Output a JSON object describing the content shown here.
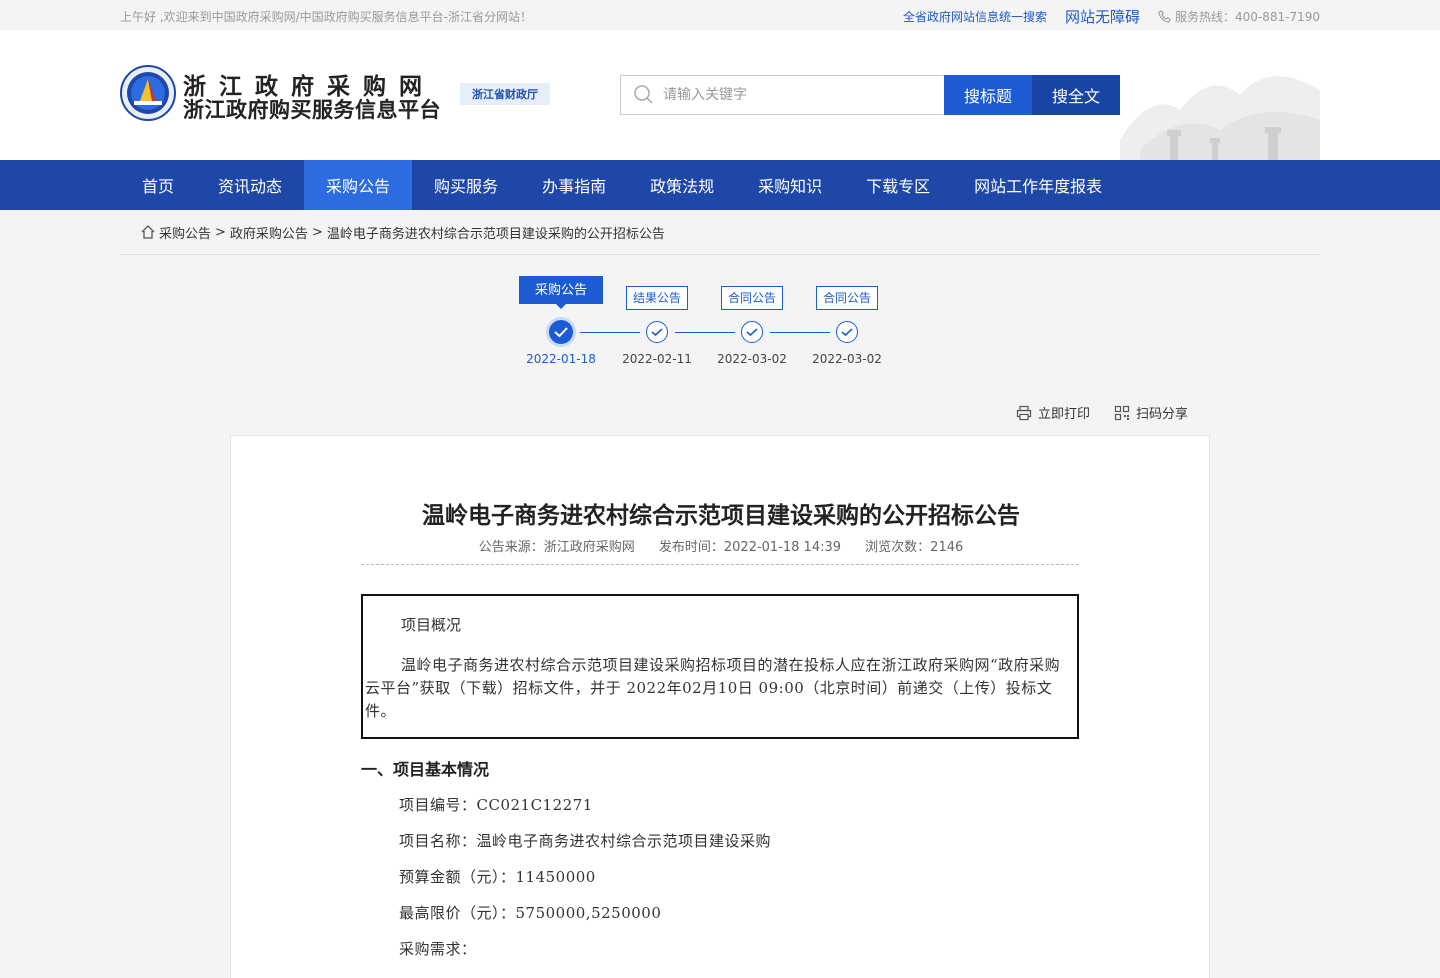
{
  "topbar": {
    "welcome": "上午好 ,欢迎来到中国政府采购网/中国政府购买服务信息平台-浙江省分网站！",
    "unified_search": "全省政府网站信息统一搜索",
    "accessibility": "网站无障碍",
    "hotline": "服务热线：400-881-7190"
  },
  "header": {
    "title": "浙江政府采购网",
    "subtitle": "浙江政府购买服务信息平台",
    "dept": "浙江省财政厅",
    "search_placeholder": "请输入关键字",
    "btn_title": "搜标题",
    "btn_full": "搜全文"
  },
  "nav": {
    "items": [
      "首页",
      "资讯动态",
      "采购公告",
      "购买服务",
      "办事指南",
      "政策法规",
      "采购知识",
      "下载专区",
      "网站工作年度报表"
    ],
    "active_index": 2
  },
  "breadcrumb": {
    "items": [
      "采购公告",
      "政府采购公告",
      "温岭电子商务进农村综合示范项目建设采购的公开招标公告"
    ],
    "separator": ">"
  },
  "timeline": {
    "steps": [
      {
        "label": "采购公告",
        "date": "2022-01-18",
        "active": true
      },
      {
        "label": "结果公告",
        "date": "2022-02-11",
        "active": false
      },
      {
        "label": "合同公告",
        "date": "2022-03-02",
        "active": false
      },
      {
        "label": "合同公告",
        "date": "2022-03-02",
        "active": false
      }
    ]
  },
  "actions": {
    "print": "立即打印",
    "share": "扫码分享"
  },
  "article": {
    "title": "温岭电子商务进农村综合示范项目建设采购的公开招标公告",
    "source": "公告来源：浙江政府采购网",
    "publish_time": "发布时间：2022-01-18 14:39",
    "views": "浏览次数：2146",
    "overview_head": "项目概况",
    "overview_body": "温岭电子商务进农村综合示范项目建设采购招标项目的潜在投标人应在浙江政府采购网“政府采购云平台”获取（下载）招标文件，并于 2022年02月10日 09:00（北京时间）前递交（上传）投标文件。",
    "section1": "一、项目基本情况",
    "project_no": "项目编号：CC021C12271",
    "project_name": "项目名称：温岭电子商务进农村综合示范项目建设采购",
    "budget": "预算金额（元）：11450000",
    "max_price": "最高限价（元）：5750000,5250000",
    "demand": "采购需求："
  },
  "colors": {
    "nav_bg": "#1e47a8",
    "nav_active": "#2d6be0",
    "accent": "#1d5bd4"
  }
}
